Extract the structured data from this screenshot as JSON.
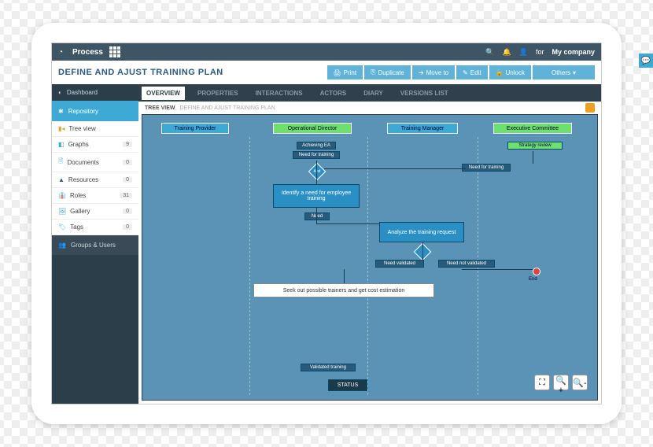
{
  "topbar": {
    "brand": "Process",
    "for_label": "for",
    "company": "My company"
  },
  "page_title": "DEFINE AND AJUST TRAINING PLAN",
  "toolbar": {
    "print": "Print",
    "duplicate": "Duplicate",
    "move_to": "Move to",
    "edit": "Edit",
    "unlock": "Unlock",
    "others": "Others"
  },
  "sidebar": {
    "dashboard": "Dashboard",
    "repository": "Repository",
    "items": [
      {
        "label": "Tree view",
        "badge": ""
      },
      {
        "label": "Graphs",
        "badge": "9"
      },
      {
        "label": "Documents",
        "badge": "0"
      },
      {
        "label": "Resources",
        "badge": "0"
      },
      {
        "label": "Roles",
        "badge": "31"
      },
      {
        "label": "Gallery",
        "badge": "0"
      },
      {
        "label": "Tags",
        "badge": "0"
      }
    ],
    "groups": "Groups & Users"
  },
  "tabs": [
    "OVERVIEW",
    "PROPERTIES",
    "INTERACTIONS",
    "ACTORS",
    "DIARY",
    "VERSIONS LIST"
  ],
  "breadcrumb": {
    "root": "TREE VIEW",
    "current": "DEFINE AND AJUST TRAINING PLAN"
  },
  "lanes": [
    "Training Provider",
    "Operational Director",
    "Training Manager",
    "Executive Committee"
  ],
  "nodes": {
    "achieving": "Achieving EA",
    "need1": "Need for training",
    "and": "And",
    "identify": "Identify a need for employee training",
    "need2": "Need",
    "analyze": "Analyze the training request",
    "or": "Or",
    "validated": "Need validated",
    "not_validated": "Need not validated",
    "seek": "Seek out possible trainers and get cost estimation",
    "strategy": "Strategy review",
    "need3": "Need for training",
    "end": "End",
    "validated_training": "Validated training",
    "status": "STATUS"
  }
}
